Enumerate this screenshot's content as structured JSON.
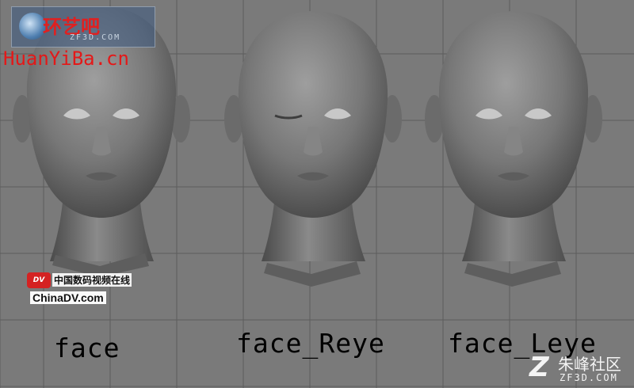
{
  "viewport": {
    "background": "#7a7a7a",
    "grid_color": "#5c5c5c",
    "models": [
      {
        "name": "face",
        "label": "face",
        "eye_state": "both-open"
      },
      {
        "name": "face_Reye",
        "label": "face_Reye",
        "eye_state": "right-closed"
      },
      {
        "name": "face_Leye",
        "label": "face_Leye",
        "eye_state": "both-open"
      }
    ]
  },
  "watermarks": {
    "huanyiba": {
      "cn": "环艺吧",
      "sub": "ZF3D.COM",
      "en": "HuanYiBa.cn",
      "color": "#e41818"
    },
    "chinadv": {
      "badge": "DV",
      "cn": "中国数码视频在线",
      "en": "ChinaDV.com"
    },
    "zf3d": {
      "mark": "Z",
      "cn": "朱峰社区",
      "en": "ZF3D.COM"
    }
  },
  "colors": {
    "skin_light": "#9a9a9a",
    "skin_dark": "#4a4a4a",
    "label_text": "#000000"
  }
}
